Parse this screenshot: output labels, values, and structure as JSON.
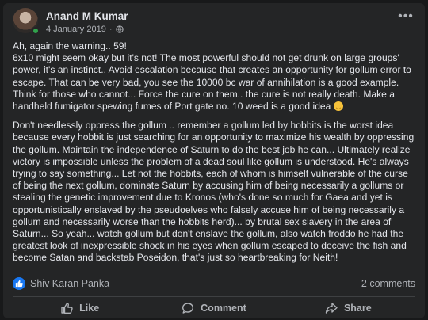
{
  "post": {
    "author": "Anand M Kumar",
    "date": "4 January 2019",
    "paragraphs": [
      "Ah, again the warning.. 59!\n6x10 might seem okay but it's not! The most powerful should not get drunk on large groups' power, it's an instinct.. Avoid escalation because that creates an opportunity for gollum error to escape. That can be very bad, you see the 10000 bc war of annihilation is a good example. Think for those who cannot... Force the cure on them.. the cure is not really death. Make a handheld fumigator spewing fumes of Port gate no. 10 weed is a good idea",
      "Don't needlessly oppress the gollum .. remember a gollum led by hobbits is the worst idea because every hobbit is just searching for an opportunity to maximize his wealth by oppressing the gollum. Maintain the independence of Saturn to do the best job he can... Ultimately realize victory is impossible unless the problem of a dead soul like gollum is understood. He's always trying to say something... Let not the hobbits, each of whom is himself vulnerable of the curse of being the next gollum, dominate Saturn by accusing him of being necessarily a gollums or stealing the genetic improvement due to Kronos (who's done so much for Gaea and yet is opportunistically enslaved by the pseudoelves who falsely accuse him of being necessarily a gollum and necessarily worse than the hobbits herd)... by brutal sex slavery in the area of Saturn... So yeah... watch gollum but don't enslave the gollum, also watch froddo he had the greatest look of inexpressible shock in his eyes when gollum escaped to deceive the fish and become Satan and backstab Poseidon, that's just so heartbreaking for Neith!"
    ]
  },
  "stats": {
    "reactor_name": "Shiv Karan Panka",
    "comments": "2 comments"
  },
  "actions": {
    "like": "Like",
    "comment": "Comment",
    "share": "Share"
  },
  "icons": {
    "privacy": "globe-icon",
    "more": "more-options-icon",
    "reaction": "thumbs-up-icon",
    "emoji": "smiling-emoji-icon"
  },
  "colors": {
    "background": "#18191a",
    "card": "#242526",
    "text_primary": "#e4e6eb",
    "text_secondary": "#b0b3b8",
    "like_blue": "#1877f2",
    "online_green": "#31a24c"
  }
}
